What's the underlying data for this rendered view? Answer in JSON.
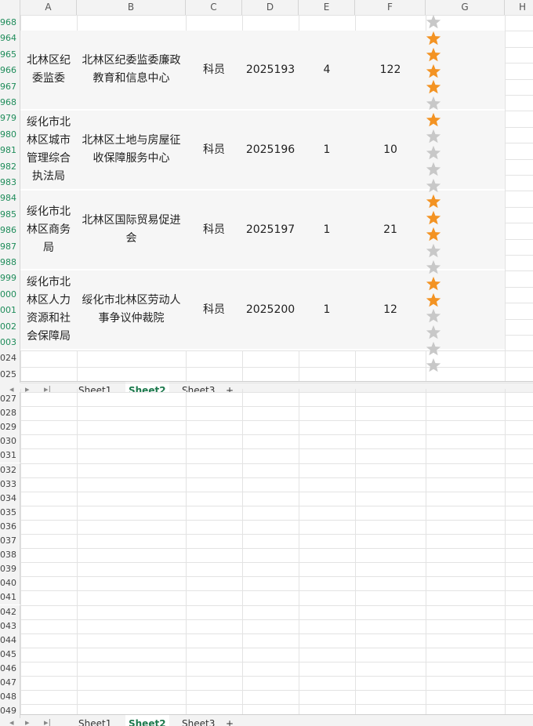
{
  "columns": [
    "A",
    "B",
    "C",
    "D",
    "E",
    "F",
    "G",
    "H"
  ],
  "top_row_numbers": [
    {
      "label": "968",
      "color": "green"
    },
    {
      "label": "964",
      "color": "green"
    },
    {
      "label": "965",
      "color": "green"
    },
    {
      "label": "966",
      "color": "green"
    },
    {
      "label": "967",
      "color": "green"
    },
    {
      "label": "968",
      "color": "green"
    },
    {
      "label": "979",
      "color": "green"
    },
    {
      "label": "980",
      "color": "green"
    },
    {
      "label": "981",
      "color": "green"
    },
    {
      "label": "982",
      "color": "green"
    },
    {
      "label": "983",
      "color": "green"
    },
    {
      "label": "984",
      "color": "green"
    },
    {
      "label": "985",
      "color": "green"
    },
    {
      "label": "986",
      "color": "green"
    },
    {
      "label": "987",
      "color": "green"
    },
    {
      "label": "988",
      "color": "green"
    },
    {
      "label": "999",
      "color": "green"
    },
    {
      "label": "000",
      "color": "green"
    },
    {
      "label": "001",
      "color": "green"
    },
    {
      "label": "002",
      "color": "green"
    },
    {
      "label": "003",
      "color": "green"
    },
    {
      "label": "024",
      "color": "gray"
    },
    {
      "label": "025",
      "color": "gray"
    }
  ],
  "bottom_row_numbers": [
    "027",
    "028",
    "029",
    "030",
    "031",
    "032",
    "033",
    "034",
    "035",
    "036",
    "037",
    "038",
    "039",
    "040",
    "041",
    "042",
    "043",
    "044",
    "045",
    "046",
    "047",
    "048",
    "049"
  ],
  "records": [
    {
      "a": "北林区纪委监委",
      "b": "北林区纪委监委廉政教育和信息中心",
      "c": "科员",
      "d": "2025193",
      "e": "4",
      "f": "122",
      "rating": 4
    },
    {
      "a": "绥化市北林区城市管理综合执法局",
      "b": "北林区土地与房屋征收保障服务中心",
      "c": "科员",
      "d": "2025196",
      "e": "1",
      "f": "10",
      "rating": 1
    },
    {
      "a": "绥化市北林区商务局",
      "b": "北林区国际贸易促进会",
      "c": "科员",
      "d": "2025197",
      "e": "1",
      "f": "21",
      "rating": 3
    },
    {
      "a": "绥化市北林区人力资源和社会保障局",
      "b": "绥化市北林区劳动人事争议仲裁院",
      "c": "科员",
      "d": "2025200",
      "e": "1",
      "f": "12",
      "rating": 2
    }
  ],
  "sheet_tabs": [
    "Sheet1",
    "Sheet2",
    "Sheet3"
  ],
  "active_tab": "Sheet2",
  "add_tab_label": "+",
  "colors": {
    "star_on": "#f39323",
    "star_off": "#c8c8c8",
    "row_num_green": "#1e8c5a",
    "cell_bg": "#f6f6f6",
    "active_tab": "#1e7a4e"
  }
}
